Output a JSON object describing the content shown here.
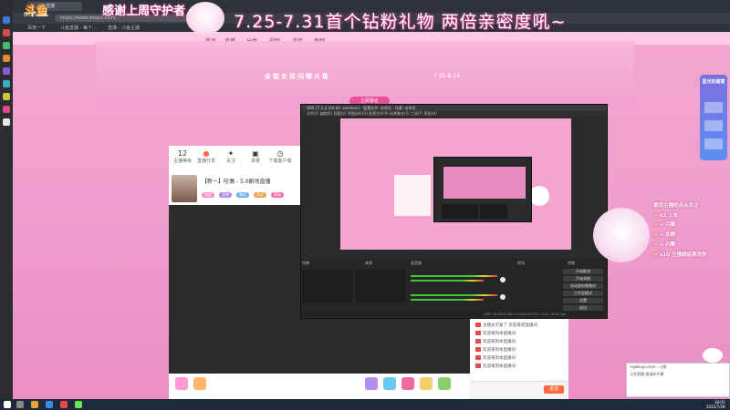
{
  "browser": {
    "url": "https://www.douyu.com/...",
    "tabs": [
      "斗鱼直播",
      "直播间 - 斗鱼",
      "斗鱼"
    ],
    "bookmarks": [
      "百度一下",
      "斗鱼直播 - 每个...",
      "直播 - 斗鱼主播",
      "斗鱼直播间"
    ]
  },
  "overlay": {
    "top_caption": "感谢上周守护者",
    "title": "7.25-7.31首个钻粉礼物 两倍亲密度吼~",
    "logo": "斗鱼",
    "logo_sub": "DOUYU.COM"
  },
  "site_nav": [
    "首页",
    "直播",
    "分类",
    "视频",
    "游戏",
    "鱼吧"
  ],
  "banner": {
    "text": "全能女孩闪耀斗鱼",
    "date": "7.25-8.14",
    "button": "立即报名"
  },
  "info_bar": {
    "items": [
      {
        "num": "12",
        "label": "主播等级"
      },
      {
        "num": "",
        "label": "直播分享"
      },
      {
        "num": "",
        "label": "关注"
      },
      {
        "num": "",
        "label": "举报"
      },
      {
        "num": "",
        "label": "下载客户端"
      }
    ]
  },
  "room": {
    "title": "【新一】哇偶 - 5.0剧场直播",
    "tags": [
      "颜值",
      "女神",
      "舞蹈",
      "声优",
      "萌妹"
    ]
  },
  "chat": {
    "lines": [
      "主播太可爱了 欢迎来到直播间",
      "欢迎来到本直播间",
      "欢迎来到本直播间",
      "欢迎来到本直播间",
      "欢迎来到本直播间",
      "欢迎来到本直播间",
      "欢迎来到本直播间"
    ],
    "send": "发送"
  },
  "obs": {
    "title": "OBS 27.2.4 (64-bit, windows) - 配置文件: 未命名 - 场景: 未命名",
    "menu": "文件(F)  编辑(E)  视图(V)  停靠部件(D)  配置文件(P)  场景集合(S)  工具(T)  帮助(H)",
    "scenes_label": "场景",
    "sources_label": "来源",
    "mixer_label": "混音器",
    "transitions_label": "转场",
    "controls_label": "控制",
    "buttons": [
      "开始推流",
      "开始录制",
      "启动虚拟摄像机",
      "工作室模式",
      "设置",
      "退出"
    ],
    "status": "LIVE: 00:00:00  REC: 00:00:00  CPU: 3.1%, 30.00 fps"
  },
  "right_ad": {
    "text": "星光的盛宴"
  },
  "rewards": [
    {
      "prefix": "喜欢主播的点点关注",
      "hl": ""
    },
    {
      "prefix": "x2 上车",
      "hl": ""
    },
    {
      "prefix": "+ 闪擎",
      "hl": ""
    },
    {
      "prefix": "+ 加群",
      "hl": ""
    },
    {
      "prefix": "+ 闪擎",
      "hl": ""
    },
    {
      "prefix": "+ 闪擎",
      "hl": ""
    },
    {
      "prefix": "x10 主播超级喜欢你",
      "hl": ""
    }
  ],
  "notification": {
    "title": "rngdsuyu.com - 斗鱼",
    "body": "斗鱼直播 邀请你开播"
  },
  "taskbar": {
    "time": "18:03",
    "date": "2022/7/28"
  }
}
